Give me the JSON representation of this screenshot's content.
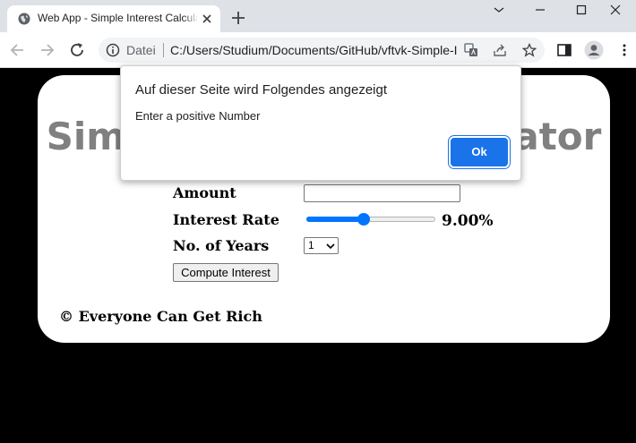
{
  "browser": {
    "tab_title": "Web App - Simple Interest Calculator",
    "scheme_label": "Datei",
    "url": "C:/Users/Studium/Documents/GitHub/vftvk-Simple-Interest-Calculator/index.html",
    "icons": [
      "globe-icon",
      "close-icon",
      "plus-icon",
      "back-arrow-icon",
      "forward-arrow-icon",
      "reload-icon",
      "info-icon",
      "translate-icon",
      "share-icon",
      "star-icon",
      "side-panel-icon",
      "profile-icon",
      "kebab-menu-icon",
      "minimize-icon",
      "maximize-icon",
      "window-close-icon",
      "chevron-down-icon"
    ]
  },
  "page": {
    "title": "Simple Interest Calculator",
    "amount_label": "Amount",
    "amount_value": "",
    "rate_label": "Interest Rate",
    "rate_value": "9.00%",
    "rate_level": 0.44,
    "years_label": "No. of Years",
    "years_selected": "1",
    "compute_button": "Compute Interest",
    "footer": "© Everyone Can Get Rich"
  },
  "dialog": {
    "title": "Auf dieser Seite wird Folgendes angezeigt",
    "message": "Enter a positive Number",
    "ok_label": "Ok"
  },
  "colors": {
    "page_background": "#000000",
    "card_background": "#ffffff",
    "title_color": "#808080",
    "accent": "#1a73e8",
    "slider": "#0075ff"
  }
}
